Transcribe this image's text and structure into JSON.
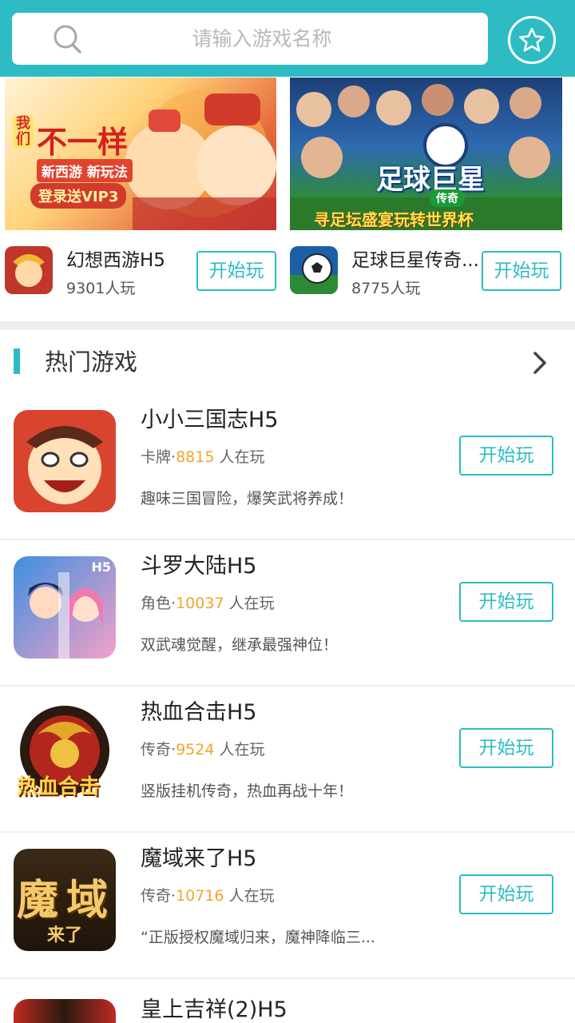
{
  "search": {
    "placeholder": "请输入游戏名称"
  },
  "icons": {
    "search": "search-icon",
    "favorite": "star-icon",
    "more": "chevron-right-icon"
  },
  "colors": {
    "accent": "#2dbcc3",
    "count": "#f0a624"
  },
  "banners": [
    {
      "caption_lines": [
        "我们",
        "不一样",
        "新西游 新玩法",
        "登录送VIP3"
      ]
    },
    {
      "caption_lines": [
        "足球巨星",
        "传奇",
        "寻足坛盛宴玩转世界杯"
      ]
    }
  ],
  "featured": [
    {
      "name": "幻想西游H5",
      "players": "9301人玩",
      "button": "开始玩"
    },
    {
      "name": "足球巨星传奇...",
      "players": "8775人玩",
      "button": "开始玩"
    }
  ],
  "section": {
    "title": "热门游戏"
  },
  "games": [
    {
      "title": "小小三国志H5",
      "category": "卡牌",
      "count": "8815",
      "suffix": "人在玩",
      "desc": "趣味三国冒险，爆笑武将养成！",
      "button": "开始玩"
    },
    {
      "title": "斗罗大陆H5",
      "category": "角色",
      "count": "10037",
      "suffix": "人在玩",
      "desc": "双武魂觉醒，继承最强神位！",
      "button": "开始玩",
      "icon_text": "H5"
    },
    {
      "title": "热血合击H5",
      "category": "传奇",
      "count": "9524",
      "suffix": "人在玩",
      "desc": "竖版挂机传奇，热血再战十年！",
      "button": "开始玩",
      "icon_text": "热血合击"
    },
    {
      "title": "魔域来了H5",
      "category": "传奇",
      "count": "10716",
      "suffix": "人在玩",
      "desc": "“正版授权魔域归来，魔神降临三...",
      "button": "开始玩",
      "icon_text": [
        "魔",
        "域",
        "来了"
      ]
    },
    {
      "title": "皇上吉祥(2)H5"
    }
  ]
}
